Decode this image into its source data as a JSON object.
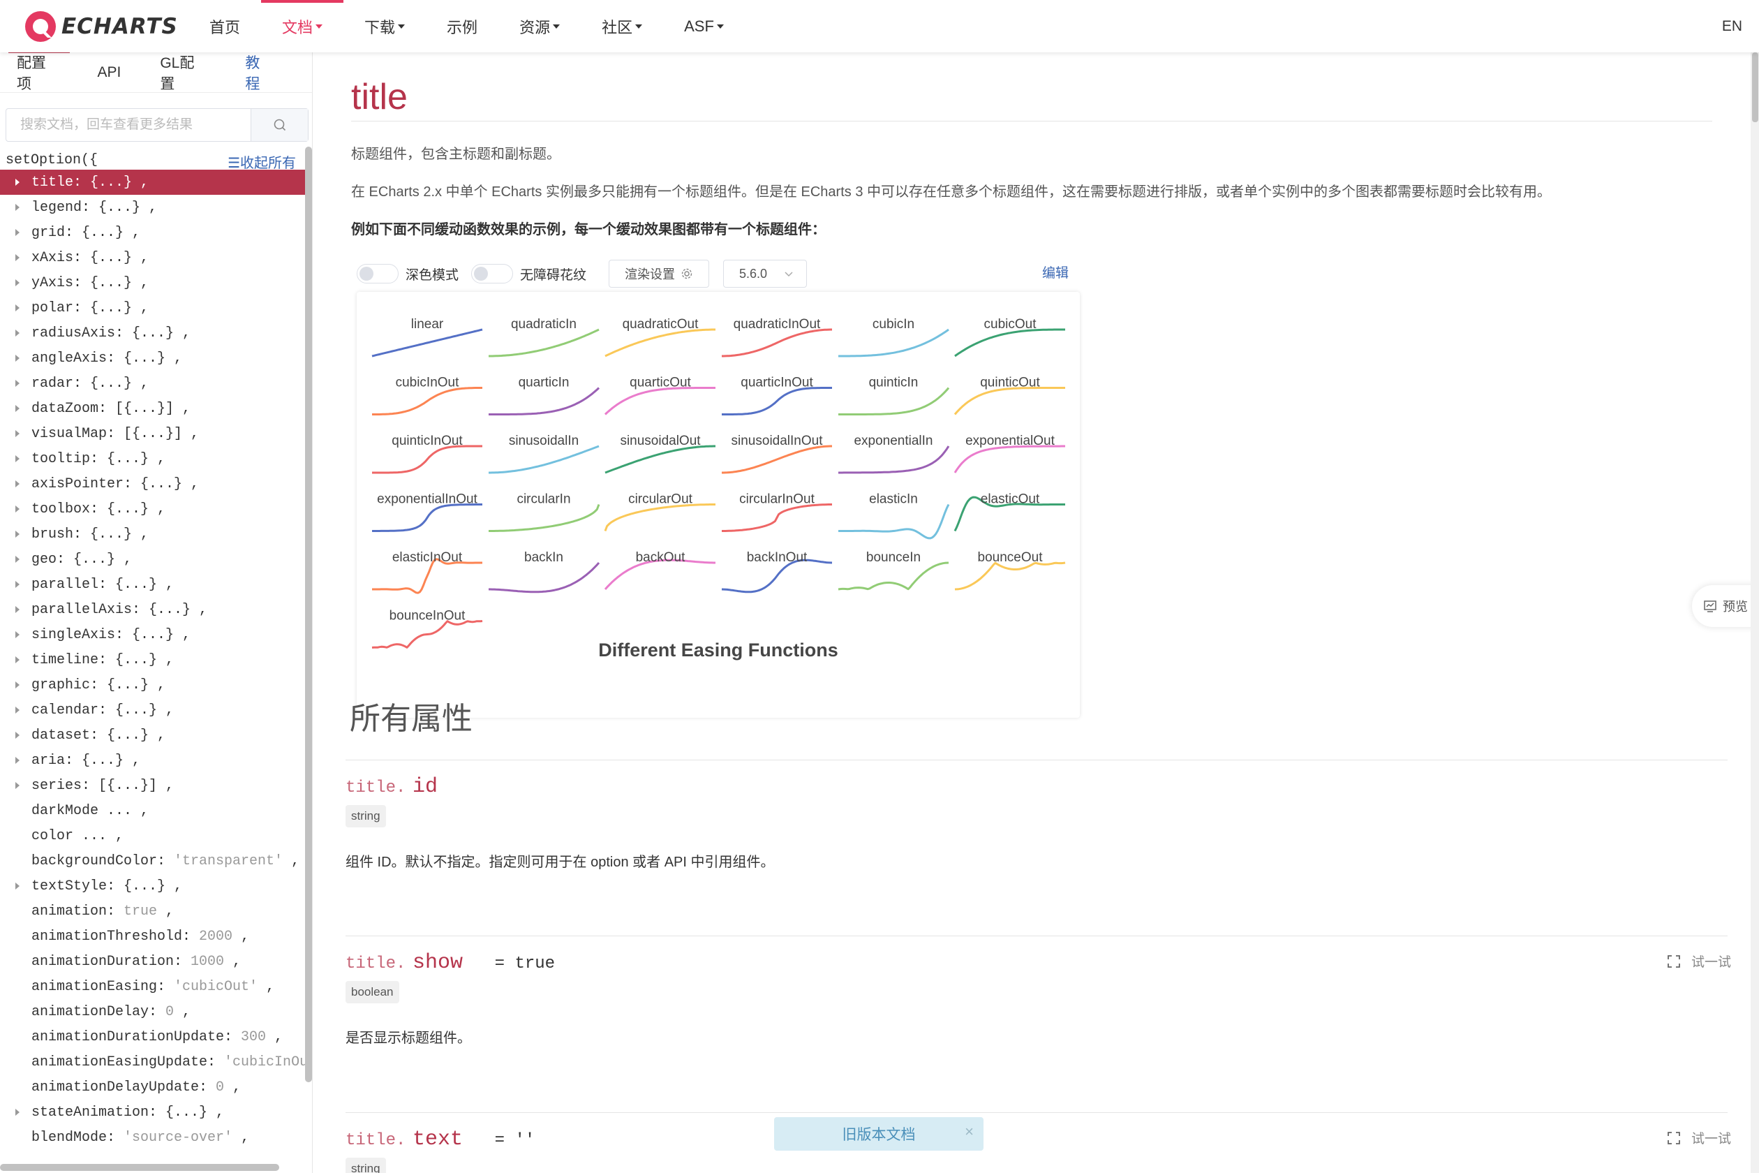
{
  "navbar": {
    "logo_text": "ECHARTS",
    "items": [
      {
        "label": "首页",
        "dropdown": false,
        "active": false
      },
      {
        "label": "文档",
        "dropdown": true,
        "active": true
      },
      {
        "label": "下载",
        "dropdown": true,
        "active": false
      },
      {
        "label": "示例",
        "dropdown": false,
        "active": false
      },
      {
        "label": "资源",
        "dropdown": true,
        "active": false
      },
      {
        "label": "社区",
        "dropdown": true,
        "active": false
      },
      {
        "label": "ASF",
        "dropdown": true,
        "active": false
      }
    ],
    "lang": "EN",
    "accent_color": "#e43961"
  },
  "sidebar": {
    "tabs": [
      "配置项",
      "API",
      "GL配置",
      "教程"
    ],
    "search_placeholder": "搜索文档，回车查看更多结果",
    "tree_head": "setOption({",
    "collapse_all": "☰收起所有",
    "items": [
      {
        "key": "title:",
        "val": "",
        "suffix": "{...} ,",
        "arrow": true,
        "selected": true
      },
      {
        "key": "legend:",
        "val": "",
        "suffix": "{...} ,",
        "arrow": true
      },
      {
        "key": "grid:",
        "val": "",
        "suffix": "{...} ,",
        "arrow": true
      },
      {
        "key": "xAxis:",
        "val": "",
        "suffix": "{...} ,",
        "arrow": true
      },
      {
        "key": "yAxis:",
        "val": "",
        "suffix": "{...} ,",
        "arrow": true
      },
      {
        "key": "polar:",
        "val": "",
        "suffix": "{...} ,",
        "arrow": true
      },
      {
        "key": "radiusAxis:",
        "val": "",
        "suffix": "{...} ,",
        "arrow": true
      },
      {
        "key": "angleAxis:",
        "val": "",
        "suffix": "{...} ,",
        "arrow": true
      },
      {
        "key": "radar:",
        "val": "",
        "suffix": "{...} ,",
        "arrow": true
      },
      {
        "key": "dataZoom:",
        "val": "",
        "suffix": "[{...}] ,",
        "arrow": true
      },
      {
        "key": "visualMap:",
        "val": "",
        "suffix": "[{...}] ,",
        "arrow": true
      },
      {
        "key": "tooltip:",
        "val": "",
        "suffix": "{...} ,",
        "arrow": true
      },
      {
        "key": "axisPointer:",
        "val": "",
        "suffix": "{...} ,",
        "arrow": true
      },
      {
        "key": "toolbox:",
        "val": "",
        "suffix": "{...} ,",
        "arrow": true
      },
      {
        "key": "brush:",
        "val": "",
        "suffix": "{...} ,",
        "arrow": true
      },
      {
        "key": "geo:",
        "val": "",
        "suffix": "{...} ,",
        "arrow": true
      },
      {
        "key": "parallel:",
        "val": "",
        "suffix": "{...} ,",
        "arrow": true
      },
      {
        "key": "parallelAxis:",
        "val": "",
        "suffix": "{...} ,",
        "arrow": true
      },
      {
        "key": "singleAxis:",
        "val": "",
        "suffix": "{...} ,",
        "arrow": true
      },
      {
        "key": "timeline:",
        "val": "",
        "suffix": "{...} ,",
        "arrow": true
      },
      {
        "key": "graphic:",
        "val": "",
        "suffix": "{...} ,",
        "arrow": true
      },
      {
        "key": "calendar:",
        "val": "",
        "suffix": "{...} ,",
        "arrow": true
      },
      {
        "key": "dataset:",
        "val": "",
        "suffix": "{...} ,",
        "arrow": true
      },
      {
        "key": "aria:",
        "val": "",
        "suffix": "{...} ,",
        "arrow": true
      },
      {
        "key": "series:",
        "val": "",
        "suffix": "[{...}] ,",
        "arrow": true
      },
      {
        "key": "darkMode",
        "val": "",
        "suffix": "... ,",
        "arrow": false
      },
      {
        "key": "color",
        "val": "",
        "suffix": "... ,",
        "arrow": false
      },
      {
        "key": "backgroundColor:",
        "val": "'transparent'",
        "suffix": ",",
        "arrow": false
      },
      {
        "key": "textStyle:",
        "val": "",
        "suffix": "{...} ,",
        "arrow": true
      },
      {
        "key": "animation:",
        "val": "true",
        "suffix": ",",
        "arrow": false
      },
      {
        "key": "animationThreshold:",
        "val": "2000",
        "suffix": ",",
        "arrow": false
      },
      {
        "key": "animationDuration:",
        "val": "1000",
        "suffix": ",",
        "arrow": false
      },
      {
        "key": "animationEasing:",
        "val": "'cubicOut'",
        "suffix": ",",
        "arrow": false
      },
      {
        "key": "animationDelay:",
        "val": "0",
        "suffix": ",",
        "arrow": false
      },
      {
        "key": "animationDurationUpdate:",
        "val": "300",
        "suffix": ",",
        "arrow": false
      },
      {
        "key": "animationEasingUpdate:",
        "val": "'cubicInOut'",
        "suffix": "",
        "arrow": false
      },
      {
        "key": "animationDelayUpdate:",
        "val": "0",
        "suffix": ",",
        "arrow": false
      },
      {
        "key": "stateAnimation:",
        "val": "",
        "suffix": "{...} ,",
        "arrow": true
      },
      {
        "key": "blendMode:",
        "val": "'source-over'",
        "suffix": ",",
        "arrow": false
      }
    ]
  },
  "main": {
    "title": "title",
    "desc1": "标题组件，包含主标题和副标题。",
    "desc2": "在 ECharts 2.x 中单个 ECharts 实例最多只能拥有一个标题组件。但是在 ECharts 3 中可以存在任意多个标题组件，这在需要标题进行排版，或者单个实例中的多个图表都需要标题时会比较有用。",
    "desc3": "例如下面不同缓动函数效果的示例，每一个缓动效果图都带有一个标题组件：",
    "toolbar": {
      "dark_mode": "深色模式",
      "barrier_free": "无障碍花纹",
      "render_settings": "渲染设置",
      "version": "5.6.0",
      "edit": "编辑"
    },
    "section_title": "所有属性",
    "properties": [
      {
        "prefix": "title.",
        "name": "id",
        "default": "",
        "type": "string",
        "desc": "组件 ID。默认不指定。指定则可用于在 option 或者 API 中引用组件。",
        "try": ""
      },
      {
        "prefix": "title.",
        "name": "show",
        "default": "= true",
        "type": "boolean",
        "desc": "是否显示标题组件。",
        "try": "试一试"
      },
      {
        "prefix": "title.",
        "name": "text",
        "default": "= ''",
        "type": "string",
        "desc": "",
        "try": "试一试"
      }
    ],
    "old_doc": "旧版本文档",
    "old_doc_close": "×",
    "preview": "预览"
  },
  "chart_data": {
    "type": "line",
    "title": "Different Easing Functions",
    "palette": [
      "#5470c6",
      "#91cc75",
      "#fac858",
      "#ee6666",
      "#73c0de",
      "#3ba272",
      "#fc8452",
      "#9a60b4",
      "#ea7ccc"
    ],
    "series": [
      {
        "name": "linear"
      },
      {
        "name": "quadraticIn"
      },
      {
        "name": "quadraticOut"
      },
      {
        "name": "quadraticInOut"
      },
      {
        "name": "cubicIn"
      },
      {
        "name": "cubicOut"
      },
      {
        "name": "cubicInOut"
      },
      {
        "name": "quarticIn"
      },
      {
        "name": "quarticOut"
      },
      {
        "name": "quarticInOut"
      },
      {
        "name": "quinticIn"
      },
      {
        "name": "quinticOut"
      },
      {
        "name": "quinticInOut"
      },
      {
        "name": "sinusoidalIn"
      },
      {
        "name": "sinusoidalOut"
      },
      {
        "name": "sinusoidalInOut"
      },
      {
        "name": "exponentialIn"
      },
      {
        "name": "exponentialOut"
      },
      {
        "name": "exponentialInOut"
      },
      {
        "name": "circularIn"
      },
      {
        "name": "circularOut"
      },
      {
        "name": "circularInOut"
      },
      {
        "name": "elasticIn"
      },
      {
        "name": "elasticOut"
      },
      {
        "name": "elasticInOut"
      },
      {
        "name": "backIn"
      },
      {
        "name": "backOut"
      },
      {
        "name": "backInOut"
      },
      {
        "name": "bounceIn"
      },
      {
        "name": "bounceOut"
      },
      {
        "name": "bounceInOut"
      }
    ]
  }
}
